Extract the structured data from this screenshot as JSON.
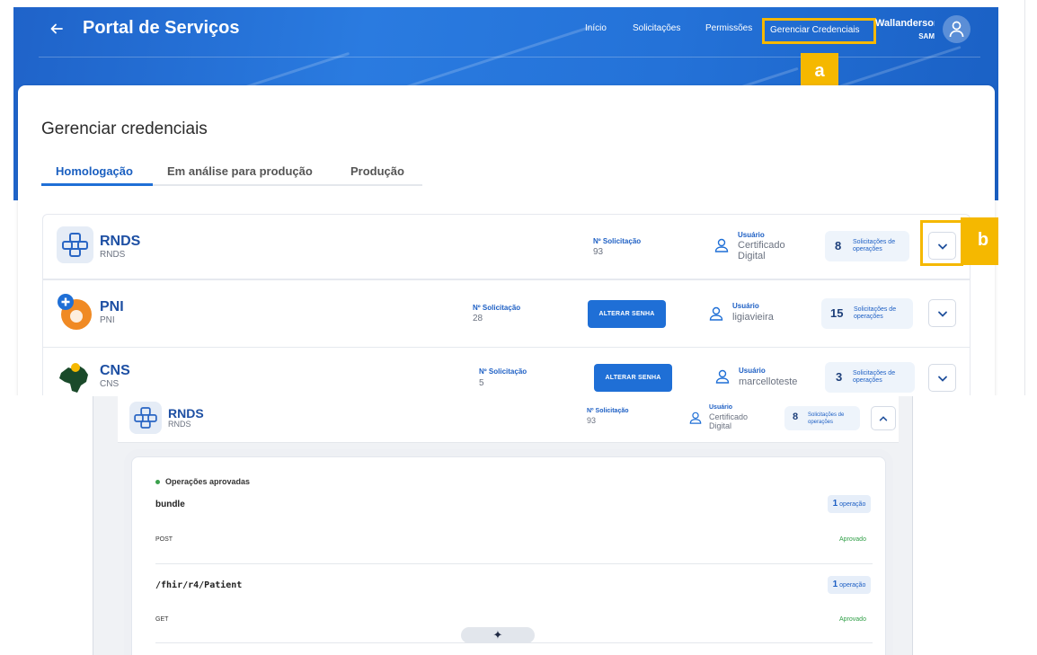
{
  "header": {
    "portal_title": "Portal de Serviços",
    "nav": [
      "Início",
      "Solicitações",
      "Permissões"
    ],
    "nav_active": "Gerenciar Credenciais",
    "user_name": "Wallanderson",
    "user_sub": "SAM"
  },
  "callouts": {
    "a": "a",
    "b": "b"
  },
  "page": {
    "title": "Gerenciar credenciais",
    "tabs": [
      "Homologação",
      "Em análise para produção",
      "Produção"
    ],
    "active_tab": "Homologação"
  },
  "services": [
    {
      "name": "RNDS",
      "sub": "RNDS",
      "sol_label": "Nº Solicitação",
      "sol_value": "93",
      "user_label": "Usuário",
      "user_value": "Certificado Digital",
      "count": "8",
      "count_label": "Solicitações de operações"
    },
    {
      "name": "PNI",
      "sub": "PNI",
      "sol_label": "Nº Solicitação",
      "sol_value": "28",
      "button": "ALTERAR SENHA",
      "user_label": "Usuário",
      "user_value": "ligiavieira",
      "count": "15",
      "count_label": "Solicitações de operações"
    },
    {
      "name": "CNS",
      "sub": "CNS",
      "sol_label": "Nº Solicitação",
      "sol_value": "5",
      "button": "ALTERAR SENHA",
      "user_label": "Usuário",
      "user_value": "marcelloteste",
      "count": "3",
      "count_label": "Solicitações de operações"
    }
  ],
  "expanded": {
    "name": "RNDS",
    "sub": "RNDS",
    "sol_label": "Nº Solicitação",
    "sol_value": "93",
    "user_label": "Usuário",
    "user_value": "Certificado Digital",
    "count": "8",
    "count_label": "Solicitações de operações",
    "section_title": "Operações aprovadas",
    "operations": [
      {
        "path": "bundle",
        "badge_count": "1",
        "badge_label": "operação",
        "method": "POST",
        "status": "Aprovado"
      },
      {
        "path": "/fhir/r4/Patient",
        "badge_count": "1",
        "badge_label": "operação",
        "method": "GET",
        "status": "Aprovado"
      }
    ],
    "float_icon": "✦"
  },
  "colors": {
    "primary": "#1f6fd6",
    "highlight": "#f5b800",
    "approved": "#2e9e45"
  }
}
